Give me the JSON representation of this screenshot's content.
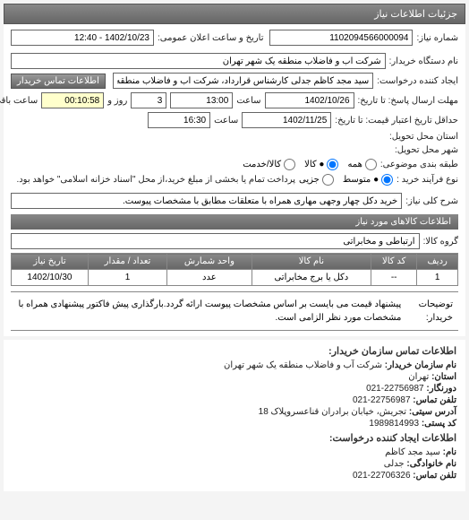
{
  "panel_title": "جزئیات اطلاعات نیاز",
  "row1": {
    "number_label": "شماره نیاز:",
    "number_value": "1102094566000094",
    "public_date_label": "تاریخ و ساعت اعلان عمومی:",
    "public_date_value": "1402/10/23 - 12:40"
  },
  "row2": {
    "buyer_org_label": "نام دستگاه خریدار:",
    "buyer_org_value": "شرکت آب و فاضلاب منطقه یک شهر تهران"
  },
  "row3": {
    "creator_label": "ایجاد کننده درخواست:",
    "creator_value": "سید مجد کاظم جدلی کارشناس قرارداد، شرکت آب و فاضلاب منطقه یک شهر",
    "contact_btn": "اطلاعات تماس خریدار"
  },
  "row4": {
    "deadline_label": "مهلت ارسال پاسخ: تا تاریخ:",
    "deadline_date": "1402/10/26",
    "deadline_time_label": "ساعت",
    "deadline_time": "13:00",
    "days_count": "3",
    "days_suffix": "روز و",
    "remain_time": "00:10:58",
    "remain_suffix": "ساعت باقی مانده"
  },
  "row5": {
    "validity_label": "حداقل تاریخ اعتبار قیمت: تا تاریخ:",
    "validity_date": "1402/11/25",
    "validity_time_label": "ساعت",
    "validity_time": "16:30"
  },
  "row6": {
    "state_label": "استان محل تحویل:"
  },
  "row7": {
    "city_label": "شهر محل تحویل:"
  },
  "row8": {
    "packaging_label": "طبقه بندی موضوعی:",
    "opt_all": "همه",
    "opt_goods": "● کالا",
    "opt_service": "کالا/خدمت"
  },
  "row9": {
    "buy_type_label": "نوع فرآیند خرید :",
    "opt_medium": "● متوسط",
    "opt_partial": "جزیی",
    "medium_note": "پرداخت تمام یا بخشی از مبلغ خرید،از محل \"اسناد خزانه اسلامی\" خواهد بود."
  },
  "row10": {
    "desc_label": "شرح کلی نیاز:",
    "desc_value": "خرید دکل چهار وجهی مهاری همراه با متعلقات مطابق با مشخصات پیوست."
  },
  "goods_section": "اطلاعات کالاهای مورد نیاز",
  "goods_group": {
    "label": "گروه کالا:",
    "value": "ارتباطی و مخابراتی"
  },
  "table": {
    "headers": [
      "ردیف",
      "کد کالا",
      "نام کالا",
      "واحد شمارش",
      "تعداد / مقدار",
      "تاریخ نیاز"
    ],
    "row": [
      "1",
      "--",
      "دکل یا برج مخابراتی",
      "عدد",
      "1",
      "1402/10/30"
    ]
  },
  "note": {
    "label": "توضیحات خریدار:",
    "text": "پیشنهاد قیمت می بایست بر اساس مشخصات پیوست ارائه گردد.بارگذاری پیش فاکتور پیشنهادی همراه با مشخصات مورد نظر الزامی است."
  },
  "buyer_contact": {
    "title": "اطلاعات تماس سازمان خریدار:",
    "org_label": "نام سازمان خریدار:",
    "org_value": "شرکت آب و فاضلاب منطقه یک شهر تهران",
    "state_label": "استان:",
    "state_value": "تهران",
    "fax_label": "دورنگار:",
    "fax_value": "22756987-021",
    "tel_label": "تلفن تماس:",
    "tel_value": "22756987-021",
    "address_label": "آدرس سیتی:",
    "address_value": "تجریش، خیابان برادران قناعسروپلاک 18",
    "postal_label": "کد پستی:",
    "postal_value": "1989814993",
    "creator_header": "اطلاعات ایجاد کننده درخواست:",
    "name_label": "نام:",
    "name_value": "سید مجد کاظم",
    "family_label": "نام خانوادگی:",
    "family_value": "جدلی",
    "phone_label": "تلفن تماس:",
    "phone_value": "22706326-021"
  }
}
